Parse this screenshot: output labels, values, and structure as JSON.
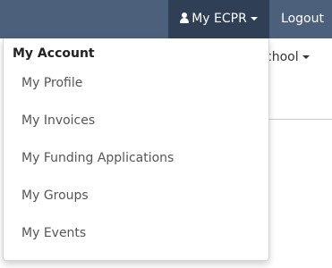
{
  "navbar": {
    "account_label": "My ECPR",
    "logout_label": "Logout"
  },
  "background": {
    "menu_label": "chool"
  },
  "dropdown": {
    "header": "My Account",
    "items": [
      {
        "label": "My Profile"
      },
      {
        "label": "My Invoices"
      },
      {
        "label": "My Funding Applications"
      },
      {
        "label": "My Groups"
      },
      {
        "label": "My Events"
      }
    ]
  },
  "colors": {
    "navbar": "#4c5f7b",
    "navbar_active": "#2f3f55",
    "menu_text": "#555555"
  },
  "icons": [
    "user-icon",
    "caret-down-icon"
  ]
}
